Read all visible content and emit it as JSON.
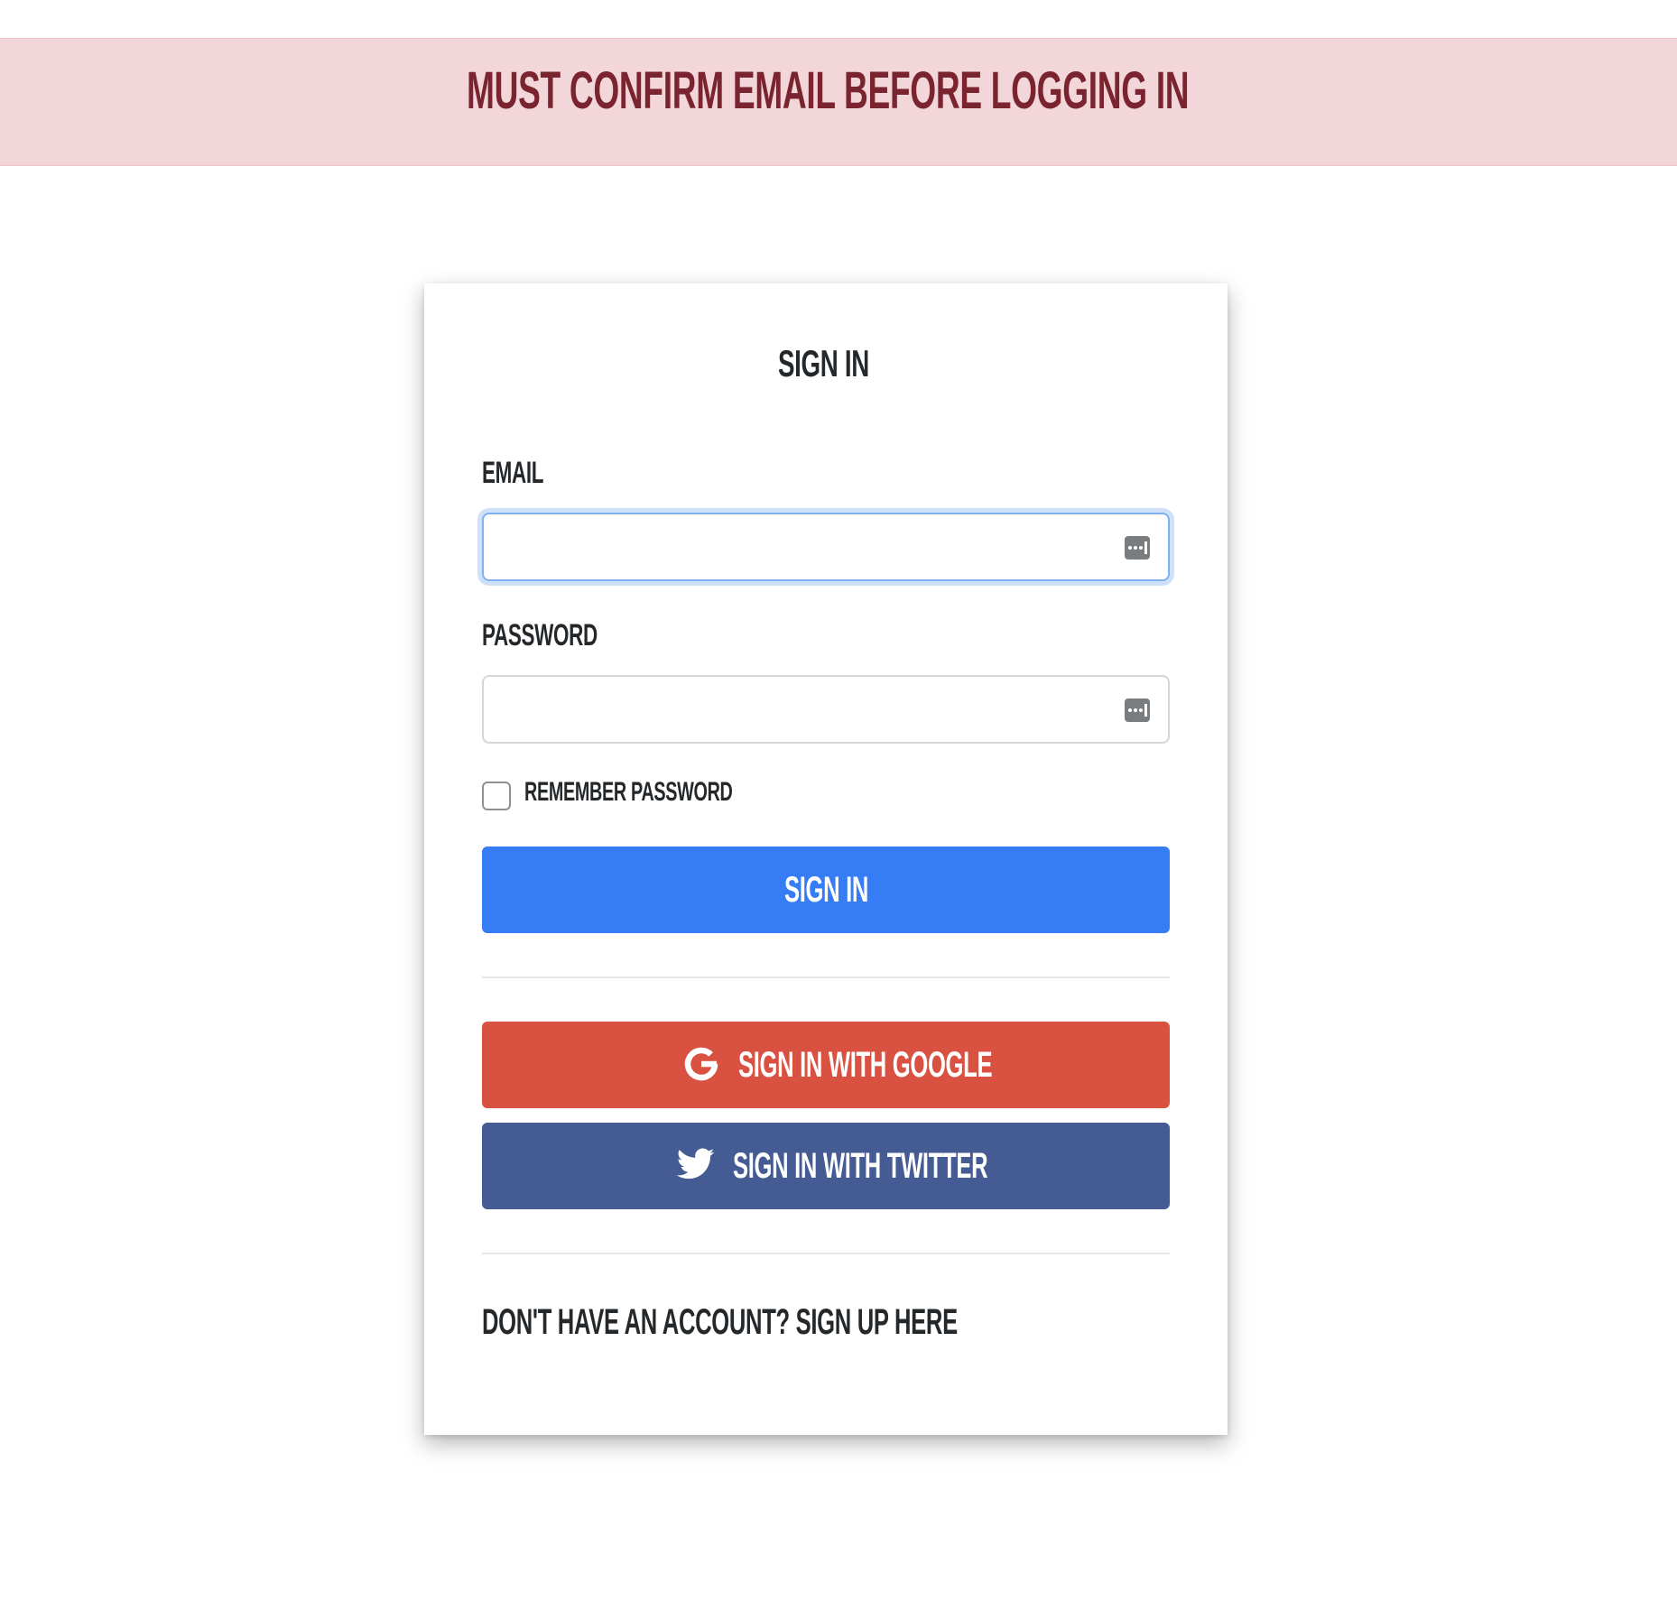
{
  "alert": {
    "message": "MUST CONFIRM EMAIL BEFORE LOGGING IN",
    "background_color": "#f3d6d9",
    "text_color": "#7a2430"
  },
  "signin_card": {
    "title": "SIGN IN",
    "email": {
      "label": "EMAIL",
      "value": "",
      "icon": "password-manager-icon",
      "focused": true
    },
    "password": {
      "label": "PASSWORD",
      "value": "",
      "icon": "password-manager-icon"
    },
    "remember": {
      "label": "REMEMBER PASSWORD",
      "checked": false
    },
    "submit_label": "SIGN IN",
    "google_label": "SIGN IN WITH GOOGLE",
    "google_icon": "google-icon",
    "twitter_label": "SIGN IN WITH TWITTER",
    "twitter_icon": "twitter-bird-icon",
    "signup_link": "DON'T HAVE AN ACCOUNT? SIGN UP HERE"
  },
  "colors": {
    "primary": "#367cf5",
    "google": "#d95141",
    "twitter": "#445c93",
    "text": "#25282b"
  }
}
